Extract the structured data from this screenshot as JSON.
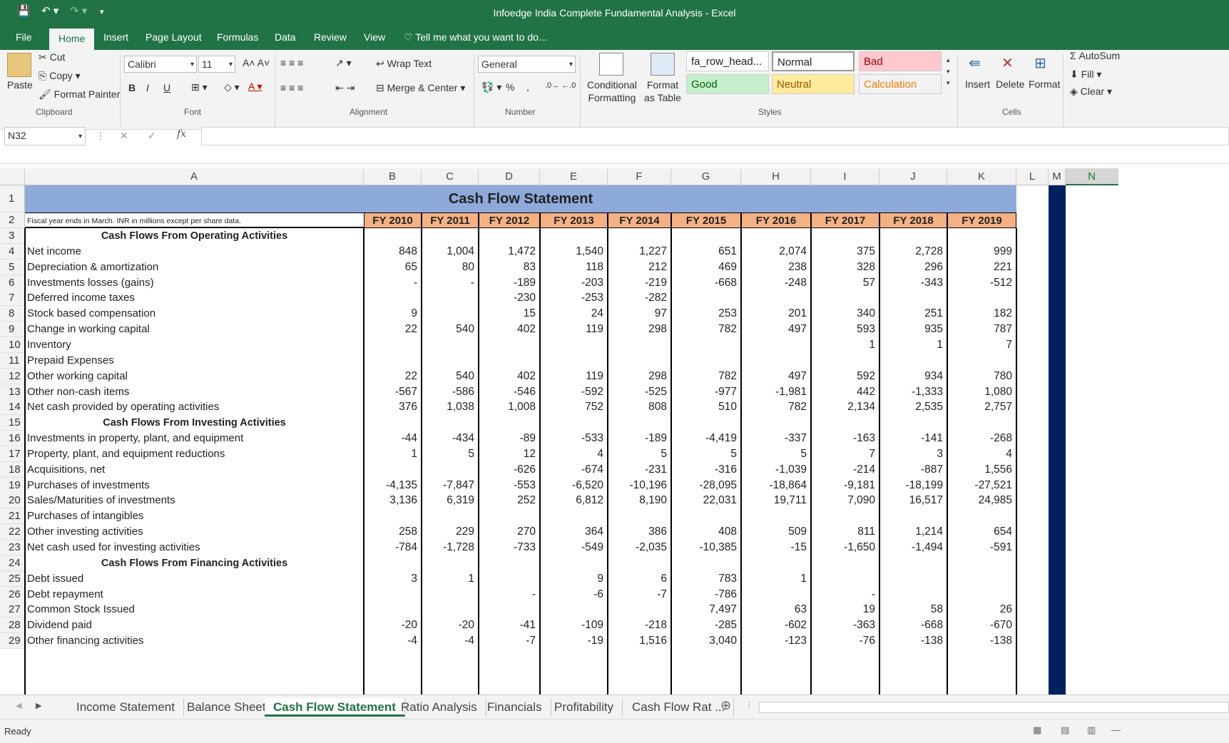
{
  "app": {
    "title": "Infoedge India Complete Fundamental Analysis - Excel"
  },
  "ribbon": {
    "tabs": [
      "File",
      "Home",
      "Insert",
      "Page Layout",
      "Formulas",
      "Data",
      "Review",
      "View"
    ],
    "tell_me": "Tell me what you want to do...",
    "clipboard": {
      "paste": "Paste",
      "cut": "Cut",
      "copy": "Copy",
      "format_painter": "Format Painter",
      "label": "Clipboard"
    },
    "font": {
      "name": "Calibri",
      "size": "11",
      "label": "Font",
      "bold": "B",
      "italic": "I",
      "underline": "U"
    },
    "alignment": {
      "wrap": "Wrap Text",
      "merge": "Merge & Center",
      "label": "Alignment"
    },
    "number": {
      "format": "General",
      "percent": "%",
      "comma": ",",
      "label": "Number"
    },
    "styles": {
      "conditional": "Conditional Formatting",
      "format_table": "Format as Table",
      "label": "Styles",
      "gallery": [
        {
          "name": "fa_row_head...",
          "bg": "#ffffff",
          "fg": "#222222"
        },
        {
          "name": "Normal",
          "bg": "#ffffff",
          "fg": "#222222"
        },
        {
          "name": "Bad",
          "bg": "#ffc7ce",
          "fg": "#9c0006"
        },
        {
          "name": "Good",
          "bg": "#c6efce",
          "fg": "#006100"
        },
        {
          "name": "Neutral",
          "bg": "#ffeb9c",
          "fg": "#9c5700"
        },
        {
          "name": "Calculation",
          "bg": "#f2f2f2",
          "fg": "#fa7d00"
        }
      ]
    },
    "cells": {
      "insert": "Insert",
      "delete": "Delete",
      "format": "Format",
      "label": "Cells"
    },
    "editing": {
      "autosum": "AutoSum",
      "fill": "Fill",
      "clear": "Clear"
    }
  },
  "formula_bar": {
    "name_box": "N32",
    "fx": "fx",
    "value": ""
  },
  "columns": [
    "A",
    "B",
    "C",
    "D",
    "E",
    "F",
    "G",
    "H",
    "I",
    "J",
    "K",
    "L",
    "M",
    "N"
  ],
  "sheet": {
    "title": "Cash Flow Statement",
    "note": "Fiscal year ends in March. INR in millions except per share data.",
    "years": [
      "FY 2010",
      "FY 2011",
      "FY 2012",
      "FY 2013",
      "FY 2014",
      "FY 2015",
      "FY 2016",
      "FY 2017",
      "FY 2018",
      "FY 2019"
    ],
    "rows": [
      {
        "n": "3",
        "label": "Cash Flows From Operating Activities",
        "section": true,
        "values": [
          "",
          "",
          "",
          "",
          "",
          "",
          "",
          "",
          "",
          ""
        ]
      },
      {
        "n": "4",
        "label": "Net income",
        "values": [
          "848",
          "1,004",
          "1,472",
          "1,540",
          "1,227",
          "651",
          "2,074",
          "375",
          "2,728",
          "999"
        ]
      },
      {
        "n": "5",
        "label": "Depreciation & amortization",
        "values": [
          "65",
          "80",
          "83",
          "118",
          "212",
          "469",
          "238",
          "328",
          "296",
          "221"
        ]
      },
      {
        "n": "6",
        "label": "Investments losses (gains)",
        "values": [
          "-",
          "-",
          "-189",
          "-203",
          "-219",
          "-668",
          "-248",
          "57",
          "-343",
          "-512"
        ]
      },
      {
        "n": "7",
        "label": "Deferred income taxes",
        "values": [
          "",
          "",
          "-230",
          "-253",
          "-282",
          "",
          "",
          "",
          "",
          ""
        ]
      },
      {
        "n": "8",
        "label": "Stock based compensation",
        "values": [
          "9",
          "",
          "15",
          "24",
          "97",
          "253",
          "201",
          "340",
          "251",
          "182"
        ]
      },
      {
        "n": "9",
        "label": "Change in working capital",
        "values": [
          "22",
          "540",
          "402",
          "119",
          "298",
          "782",
          "497",
          "593",
          "935",
          "787"
        ]
      },
      {
        "n": "10",
        "label": "Inventory",
        "values": [
          "",
          "",
          "",
          "",
          "",
          "",
          "",
          "1",
          "1",
          "7"
        ]
      },
      {
        "n": "11",
        "label": "Prepaid Expenses",
        "values": [
          "",
          "",
          "",
          "",
          "",
          "",
          "",
          "",
          "",
          ""
        ]
      },
      {
        "n": "12",
        "label": "Other working capital",
        "values": [
          "22",
          "540",
          "402",
          "119",
          "298",
          "782",
          "497",
          "592",
          "934",
          "780"
        ]
      },
      {
        "n": "13",
        "label": "Other non-cash items",
        "values": [
          "-567",
          "-586",
          "-546",
          "-592",
          "-525",
          "-977",
          "-1,981",
          "442",
          "-1,333",
          "1,080"
        ]
      },
      {
        "n": "14",
        "label": "Net cash provided by operating activities",
        "values": [
          "376",
          "1,038",
          "1,008",
          "752",
          "808",
          "510",
          "782",
          "2,134",
          "2,535",
          "2,757"
        ]
      },
      {
        "n": "15",
        "label": "Cash Flows From Investing Activities",
        "section": true,
        "values": [
          "",
          "",
          "",
          "",
          "",
          "",
          "",
          "",
          "",
          ""
        ]
      },
      {
        "n": "16",
        "label": "Investments in property, plant, and equipment",
        "values": [
          "-44",
          "-434",
          "-89",
          "-533",
          "-189",
          "-4,419",
          "-337",
          "-163",
          "-141",
          "-268"
        ]
      },
      {
        "n": "17",
        "label": "Property, plant, and equipment reductions",
        "values": [
          "1",
          "5",
          "12",
          "4",
          "5",
          "5",
          "5",
          "7",
          "3",
          "4"
        ]
      },
      {
        "n": "18",
        "label": "Acquisitions, net",
        "values": [
          "",
          "",
          "-626",
          "-674",
          "-231",
          "-316",
          "-1,039",
          "-214",
          "-887",
          "1,556"
        ]
      },
      {
        "n": "19",
        "label": "Purchases of investments",
        "values": [
          "-4,135",
          "-7,847",
          "-553",
          "-6,520",
          "-10,196",
          "-28,095",
          "-18,864",
          "-9,181",
          "-18,199",
          "-27,521"
        ]
      },
      {
        "n": "20",
        "label": "Sales/Maturities of investments",
        "values": [
          "3,136",
          "6,319",
          "252",
          "6,812",
          "8,190",
          "22,031",
          "19,711",
          "7,090",
          "16,517",
          "24,985"
        ]
      },
      {
        "n": "21",
        "label": "Purchases of intangibles",
        "values": [
          "",
          "",
          "",
          "",
          "",
          "",
          "",
          "",
          "",
          ""
        ]
      },
      {
        "n": "22",
        "label": "Other investing activities",
        "values": [
          "258",
          "229",
          "270",
          "364",
          "386",
          "408",
          "509",
          "811",
          "1,214",
          "654"
        ]
      },
      {
        "n": "23",
        "label": "Net cash used for investing activities",
        "values": [
          "-784",
          "-1,728",
          "-733",
          "-549",
          "-2,035",
          "-10,385",
          "-15",
          "-1,650",
          "-1,494",
          "-591"
        ]
      },
      {
        "n": "24",
        "label": "Cash Flows From Financing Activities",
        "section": true,
        "values": [
          "",
          "",
          "",
          "",
          "",
          "",
          "",
          "",
          "",
          ""
        ]
      },
      {
        "n": "25",
        "label": "Debt issued",
        "values": [
          "3",
          "1",
          "",
          "9",
          "6",
          "783",
          "1",
          "",
          "",
          ""
        ]
      },
      {
        "n": "26",
        "label": "Debt repayment",
        "values": [
          "",
          "",
          "-",
          "-6",
          "-7",
          "-786",
          "",
          "-",
          "",
          ""
        ]
      },
      {
        "n": "27",
        "label": "Common Stock Issued",
        "values": [
          "",
          "",
          "",
          "",
          "",
          "7,497",
          "63",
          "19",
          "58",
          "26"
        ]
      },
      {
        "n": "28",
        "label": "Dividend paid",
        "values": [
          "-20",
          "-20",
          "-41",
          "-109",
          "-218",
          "-285",
          "-602",
          "-363",
          "-668",
          "-670"
        ]
      },
      {
        "n": "29",
        "label": "Other financing activities",
        "values": [
          "-4",
          "-4",
          "-7",
          "-19",
          "1,516",
          "3,040",
          "-123",
          "-76",
          "-138",
          "-138"
        ]
      }
    ]
  },
  "sheet_tabs": [
    "Income Statement",
    "Balance Sheet",
    "Cash Flow Statement",
    "Ratio Analysis",
    "Financials",
    "Profitability",
    "Cash Flow Rat ..."
  ],
  "active_sheet": "Cash Flow Statement",
  "status": "Ready",
  "colors": {
    "excel_green": "#217346",
    "title_fill": "#8eaadb",
    "header_fill": "#f4b183",
    "column_m_fill": "#002060"
  }
}
